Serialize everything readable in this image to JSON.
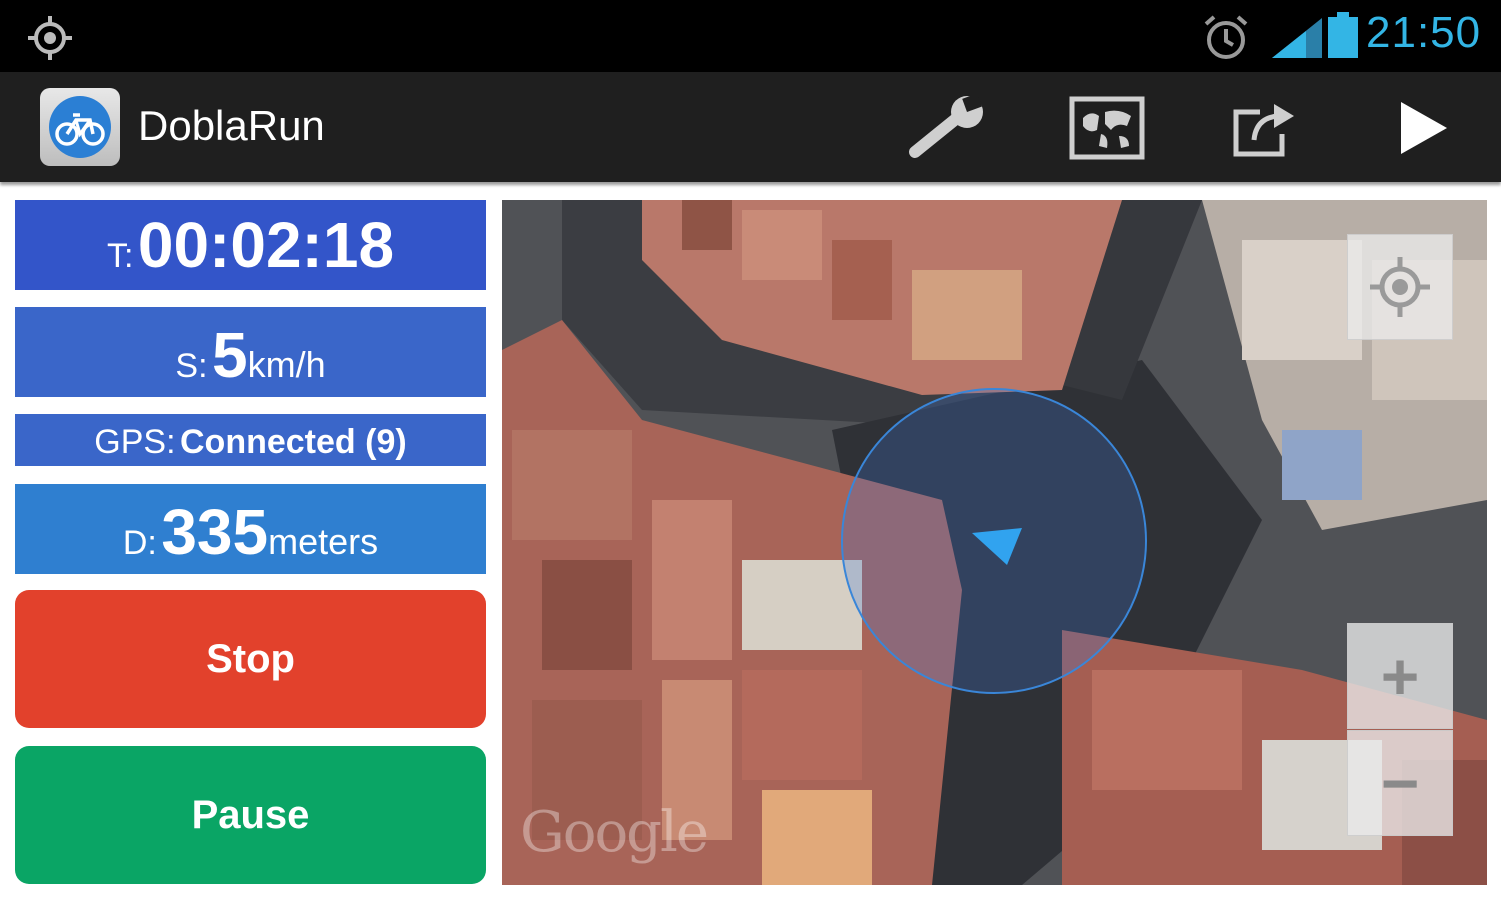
{
  "status_bar": {
    "time": "21:50",
    "icons": [
      "gps-icon",
      "alarm-clock-icon",
      "signal-icon",
      "battery-icon"
    ],
    "accent_color": "#33b5e5"
  },
  "action_bar": {
    "title": "DoblaRun",
    "app_icon": "bicycle-icon",
    "actions": [
      "wrench-icon",
      "map-icon",
      "share-icon",
      "play-icon"
    ]
  },
  "stats": {
    "time": {
      "label": "T:",
      "value": "00:02:18"
    },
    "speed": {
      "label": "S:",
      "value": "5",
      "unit": "km/h"
    },
    "gps": {
      "label": "GPS:",
      "value": "Connected (9)"
    },
    "distance": {
      "label": "D:",
      "value": "335",
      "unit": "meters"
    }
  },
  "buttons": {
    "stop": "Stop",
    "pause": "Pause"
  },
  "colors": {
    "time_panel": "#3355c9",
    "speed_panel": "#3a66c9",
    "distance_panel": "#2f7fd0",
    "stop": "#e2412c",
    "pause": "#0aa565"
  },
  "map": {
    "attribution": "Google",
    "controls": [
      "my-location-icon",
      "zoom-in-icon",
      "zoom-out-icon"
    ],
    "zoom_in": "+",
    "zoom_out": "−"
  }
}
